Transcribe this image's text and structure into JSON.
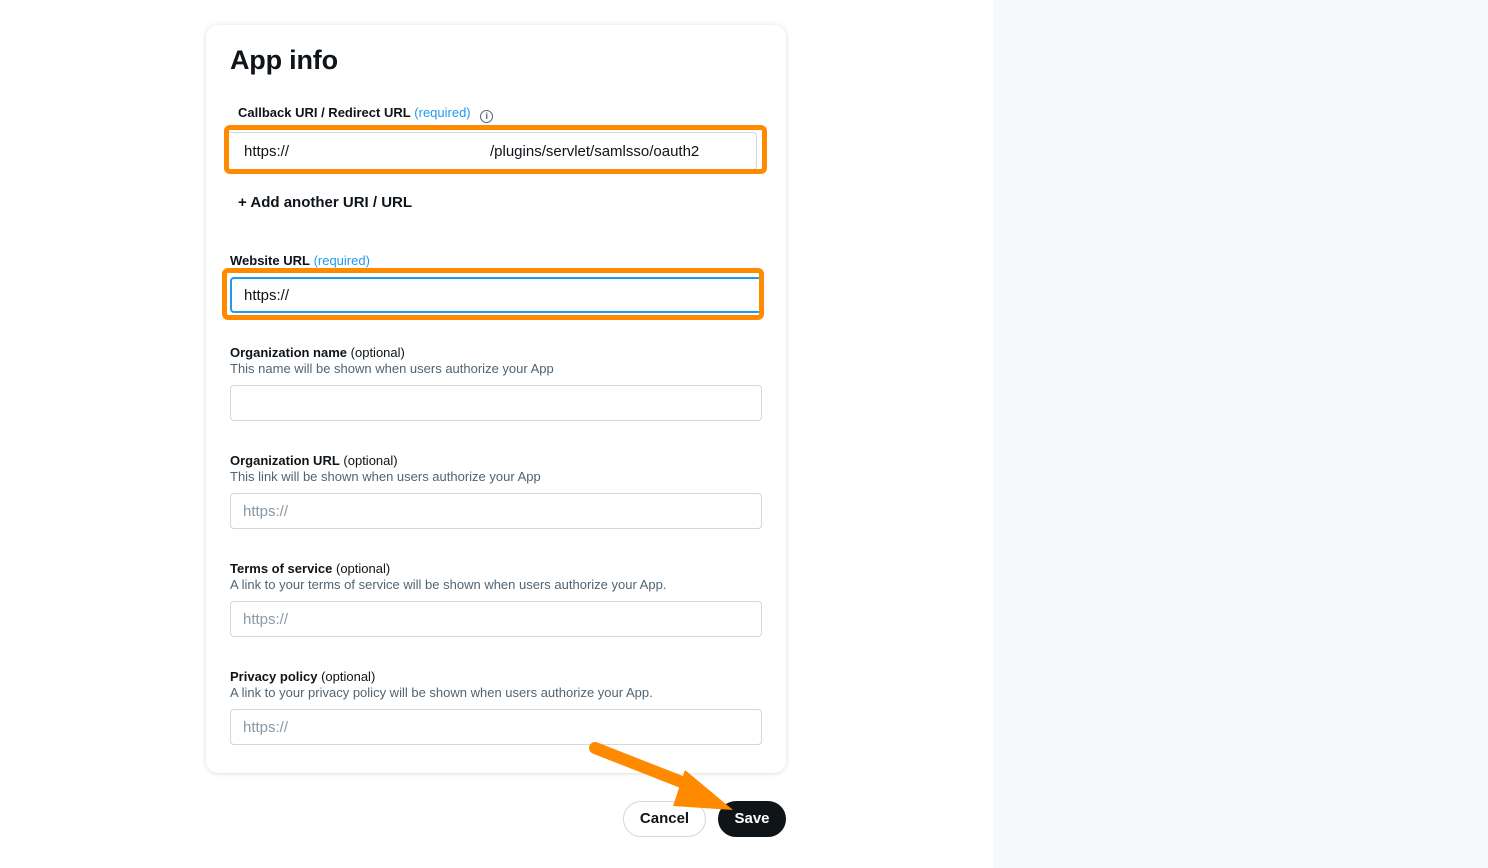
{
  "card": {
    "title": "App info",
    "callback": {
      "label": "Callback URI / Redirect URL",
      "required": "(required)",
      "info_icon": "info-icon",
      "value_prefix": "https://",
      "value_suffix": "/plugins/servlet/samlsso/oauth2",
      "add_link": "+ Add another URI / URL"
    },
    "website": {
      "label": "Website URL",
      "required": "(required)",
      "value": "https://"
    },
    "org_name": {
      "label": "Organization name",
      "optional": "(optional)",
      "help": "This name will be shown when users authorize your App",
      "value": ""
    },
    "org_url": {
      "label": "Organization URL",
      "optional": "(optional)",
      "help": "This link will be shown when users authorize your App",
      "placeholder": "https://"
    },
    "terms": {
      "label": "Terms of service",
      "optional": "(optional)",
      "help": "A link to your terms of service will be shown when users authorize your App.",
      "placeholder": "https://"
    },
    "privacy": {
      "label": "Privacy policy",
      "optional": "(optional)",
      "help": "A link to your privacy policy will be shown when users authorize your App.",
      "placeholder": "https://"
    }
  },
  "actions": {
    "cancel": "Cancel",
    "save": "Save"
  },
  "annotations": {
    "highlight_color": "#ff8a00",
    "arrow_icon": "arrow-pointer-icon"
  },
  "colors": {
    "link": "#1d9bf0",
    "primary_button": "#0f1419",
    "focus_border": "#1d9bf0"
  }
}
